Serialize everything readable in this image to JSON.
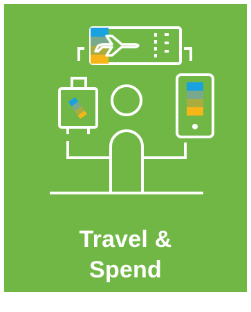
{
  "tile": {
    "title_line1": "Travel &",
    "title_line2": "Spend",
    "background_color": "#71b745",
    "line_color": "#ffffff",
    "accent_colors": [
      "#1aa1e0",
      "#78a98c",
      "#a9ad3f",
      "#f7b617"
    ]
  },
  "icons": {
    "ticket": "airplane-ticket-icon",
    "luggage": "luggage-icon",
    "phone": "smartphone-icon",
    "person": "person-icon"
  }
}
